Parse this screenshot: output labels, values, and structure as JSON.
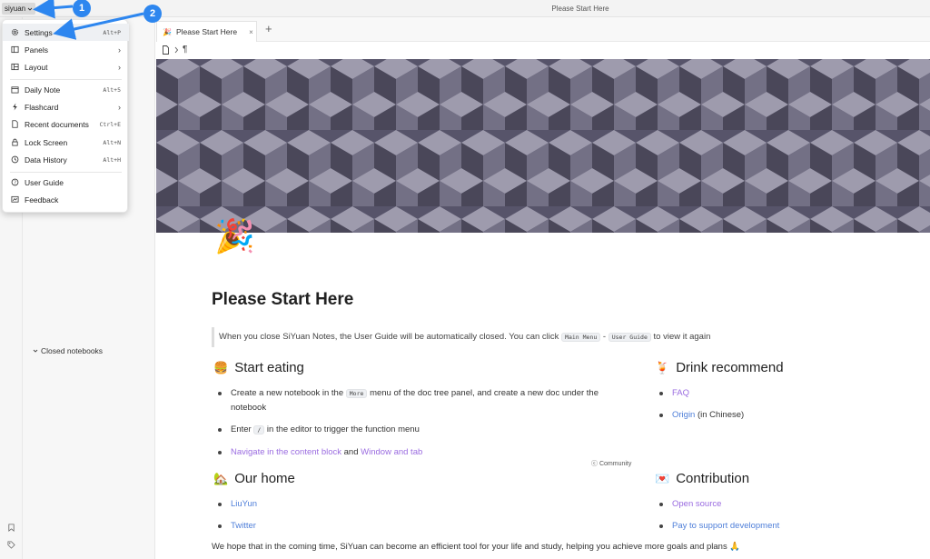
{
  "workspace": {
    "name": "siyuan"
  },
  "window": {
    "title": "Please Start Here"
  },
  "tab": {
    "label": "Please Start Here",
    "close": "×",
    "new": "+"
  },
  "filetree": {
    "closed_notebooks": "Closed notebooks"
  },
  "menu": {
    "items": [
      {
        "label": "Settings",
        "shortcut": "Alt+P",
        "icon": "gear-icon"
      },
      {
        "label": "Panels",
        "arrow": "›",
        "icon": "panels-icon"
      },
      {
        "label": "Layout",
        "arrow": "›",
        "icon": "layout-icon"
      },
      {
        "label": "Daily Note",
        "shortcut": "Alt+5",
        "icon": "calendar-icon"
      },
      {
        "label": "Flashcard",
        "arrow": "›",
        "icon": "flash-icon"
      },
      {
        "label": "Recent documents",
        "shortcut": "Ctrl+E",
        "icon": "document-icon"
      },
      {
        "label": "Lock Screen",
        "shortcut": "Alt+N",
        "icon": "lock-icon"
      },
      {
        "label": "Data History",
        "shortcut": "Alt+H",
        "icon": "history-icon"
      },
      {
        "label": "User Guide",
        "icon": "help-icon"
      },
      {
        "label": "Feedback",
        "icon": "feedback-icon"
      }
    ]
  },
  "annotations": {
    "one": "1",
    "two": "2"
  },
  "doc": {
    "title": "Please Start Here",
    "quote": {
      "before": "When you close SiYuan Notes, the User Guide will be automatically closed. You can click",
      "code1": "Main Menu",
      "dash": "-",
      "code2": "User Guide",
      "after": "to view it again"
    },
    "start_eating": {
      "heading": "Start eating",
      "emoji": "🍔",
      "item1_a": "Create a new notebook in the",
      "item1_code": "More",
      "item1_b": "menu of the doc tree panel, and create a new doc under the notebook",
      "item2_a": "Enter",
      "item2_code": "/",
      "item2_b": "in the editor to trigger the function menu",
      "item3_link1": "Navigate in the content block",
      "item3_and": "and",
      "item3_link2": "Window and tab"
    },
    "drink": {
      "heading": "Drink recommend",
      "emoji": "🍹",
      "item1": "FAQ",
      "item2_link": "Origin",
      "item2_rest": "(in Chinese)"
    },
    "community": "Community",
    "our_home": {
      "heading": "Our home",
      "emoji": "🏡",
      "item1": "LiuYun",
      "item2": "Twitter"
    },
    "contribution": {
      "heading": "Contribution",
      "emoji": "💌",
      "item1": "Open source",
      "item2": "Pay to support development"
    },
    "footer": "We hope that in the coming time, SiYuan can become an efficient tool for your life and study, helping you achieve more goals and plans",
    "footer_emoji": "🙏"
  }
}
